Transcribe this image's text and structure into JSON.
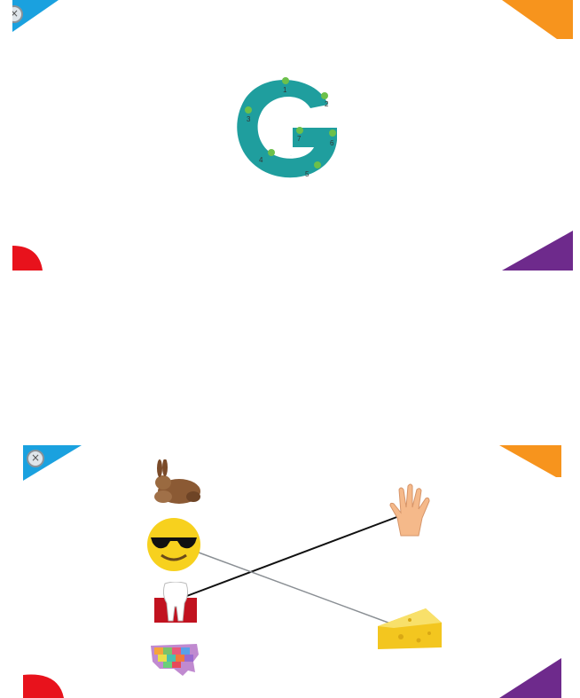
{
  "letter_screen": {
    "letter": "G",
    "dot_numbers": [
      "1",
      "2",
      "3",
      "4",
      "5",
      "6",
      "7"
    ],
    "colors": {
      "letter_fill": "#1f9e9e",
      "dot_fill": "#6cc04a",
      "corner_top_left": "#1aa1df",
      "corner_top_right": "#f7941d",
      "corner_bottom_left": "#e8121c",
      "corner_bottom_right": "#6e2a8c"
    },
    "close_icon": "close-icon"
  },
  "match_screen": {
    "left_items": [
      {
        "name": "rabbit",
        "icon": "rabbit-picture"
      },
      {
        "name": "sunglasses-face",
        "icon": "sunglasses-emoji"
      },
      {
        "name": "tooth",
        "icon": "tooth-picture"
      },
      {
        "name": "usa-map",
        "icon": "usa-map-picture"
      }
    ],
    "right_items": [
      {
        "name": "hand",
        "icon": "hand-picture"
      },
      {
        "name": "cheese",
        "icon": "cheese-picture"
      }
    ],
    "connections": [
      {
        "from": "tooth",
        "to": "hand",
        "color": "#111111"
      },
      {
        "from": "sunglasses-face",
        "to": "cheese",
        "color": "#8a8f94"
      }
    ],
    "close_icon": "close-icon"
  }
}
